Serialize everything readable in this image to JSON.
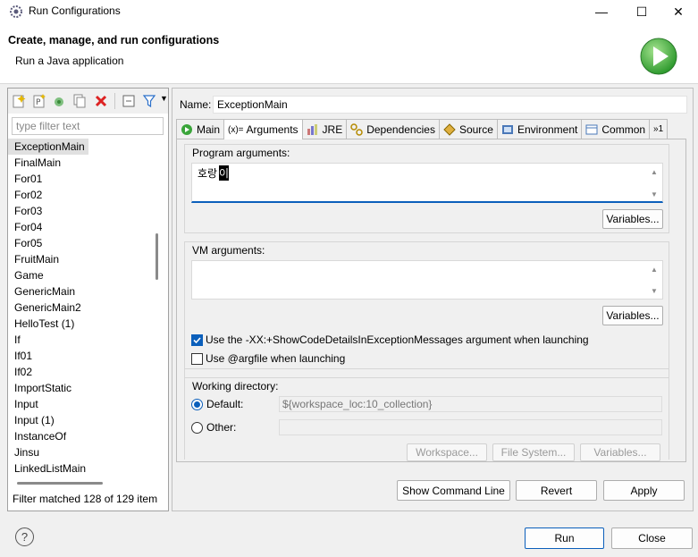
{
  "window": {
    "title": "Run Configurations",
    "minimize": "—",
    "maximize": "☐",
    "close": "✕"
  },
  "header": {
    "title": "Create, manage, and run configurations",
    "subtitle": "Run a Java application"
  },
  "left": {
    "filter_placeholder": "type filter text",
    "items": [
      "ExceptionMain",
      "FinalMain",
      "For01",
      "For02",
      "For03",
      "For04",
      "For05",
      "FruitMain",
      "Game",
      "GenericMain",
      "GenericMain2",
      "HelloTest (1)",
      "If",
      "If01",
      "If02",
      "ImportStatic",
      "Input",
      "Input (1)",
      "InstanceOf",
      "Jinsu",
      "LinkedListMain"
    ],
    "status": "Filter matched 128 of 129 item"
  },
  "config": {
    "name_label": "Name:",
    "name_value": "ExceptionMain",
    "tabs": [
      {
        "label": "Main",
        "icon": "main-icon"
      },
      {
        "label": "Arguments",
        "prefix": "(x)=",
        "icon": "arguments-icon"
      },
      {
        "label": "JRE",
        "icon": "jre-icon"
      },
      {
        "label": "Dependencies",
        "icon": "dependencies-icon"
      },
      {
        "label": "Source",
        "icon": "source-icon"
      },
      {
        "label": "Environment",
        "icon": "environment-icon"
      },
      {
        "label": "Common",
        "icon": "common-icon"
      },
      {
        "label": "»1",
        "icon": "more-tabs-icon"
      }
    ],
    "program_args": {
      "title": "Program arguments:",
      "value_plain": "호랑",
      "value_selected": "이",
      "variables": "Variables..."
    },
    "vm_args": {
      "title": "VM arguments:",
      "value": "",
      "variables": "Variables..."
    },
    "checkbox_show_code": "Use the -XX:+ShowCodeDetailsInExceptionMessages argument when launching",
    "checkbox_argfile": "Use @argfile when launching",
    "working_dir": {
      "title": "Working directory:",
      "default_label": "Default:",
      "default_value": "${workspace_loc:10_collection}",
      "other_label": "Other:",
      "workspace_btn": "Workspace...",
      "filesystem_btn": "File System...",
      "variables_btn": "Variables..."
    }
  },
  "actions": {
    "show_command_line": "Show Command Line",
    "revert": "Revert",
    "apply": "Apply"
  },
  "footer": {
    "run": "Run",
    "close": "Close",
    "help": "?"
  },
  "colors": {
    "accent": "#0b5fbb",
    "run_green": "#3aa53a"
  }
}
